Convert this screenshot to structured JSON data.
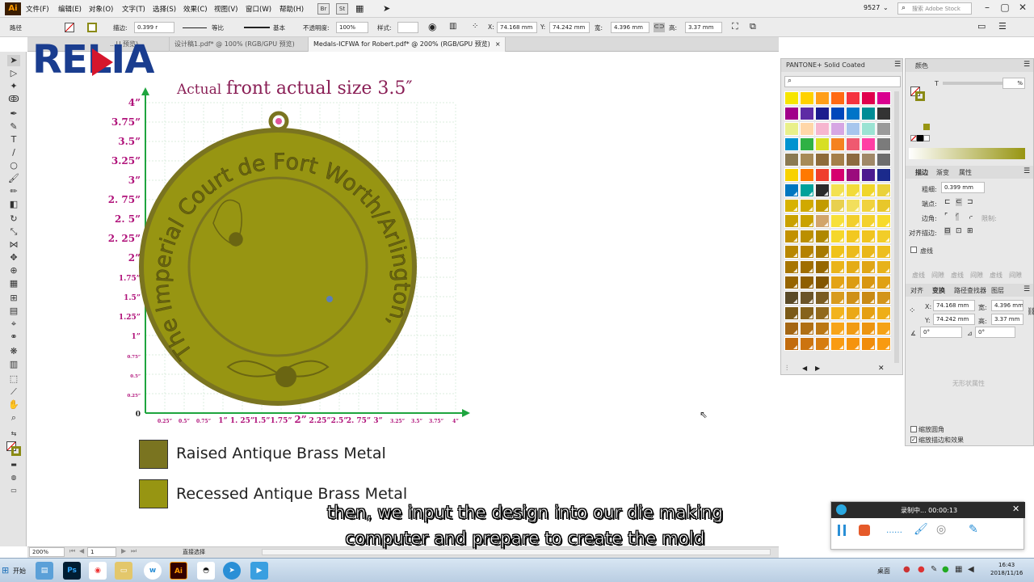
{
  "menubar": {
    "items": [
      "文件(F)",
      "编辑(E)",
      "对象(O)",
      "文字(T)",
      "选择(S)",
      "效果(C)",
      "视图(V)",
      "窗口(W)",
      "帮助(H)"
    ],
    "app_icon": "Ai",
    "bridge_btn": "Br",
    "stock_btn": "St",
    "workspace_value": "9527",
    "search_placeholder": "搜索 Adobe Stock"
  },
  "controlbar": {
    "path_label": "路径",
    "stroke_label": "描边:",
    "stroke_value": "0.399 r",
    "profile_value": "等比",
    "brush_value": "基本",
    "opacity_label": "不透明度:",
    "opacity_value": "100%",
    "style_label": "样式:",
    "x_label": "X:",
    "x_value": "74.168 mm",
    "y_label": "Y:",
    "y_value": "74.242 mm",
    "w_label": "宽:",
    "w_value": "4.396 mm",
    "h_label": "高:",
    "h_value": "3.37 mm"
  },
  "doctabs": [
    {
      "label": "...U 预览)"
    },
    {
      "label": "设计稿1.pdf* @ 100% (RGB/GPU 预览)"
    },
    {
      "label": "Medals-ICFWA for Robert.pdf* @ 200% (RGB/GPU 预览)"
    }
  ],
  "watermark": {
    "brand": "RELIA"
  },
  "artboard": {
    "title_small": "Actual",
    "title_large": "front actual size 3.5″",
    "y_ticks": [
      "4”",
      "3.75”",
      "3.5”",
      "3.25”",
      "3”",
      "2. 75”",
      "2. 5”",
      "2. 25”",
      "2”",
      "1.75”",
      "1.5”",
      "1.25”",
      "1”",
      "0.75”",
      "0.5”",
      "0.25”",
      "0"
    ],
    "x_ticks": [
      "0.25”",
      "0.5”",
      "0.75”",
      "1”",
      "1. 25”",
      "1.5”",
      "1.75”",
      "2”",
      "2.25”",
      "2.5”",
      "2. 75”",
      "3”",
      "3.25”",
      "3.5”",
      "3.75”",
      "4”"
    ],
    "medal_text": "The Imperial Court de Fort Worth/Arlington, Inc",
    "legend": [
      {
        "label": "Raised Antique  Brass Metal",
        "color": "#7a7420"
      },
      {
        "label": "Recessed  Antique  Brass Metal",
        "color": "#979512"
      }
    ]
  },
  "swatches_panel": {
    "title": "PANTONE+ Solid Coated",
    "colors_rows": [
      [
        "#f6e500",
        "#ffd200",
        "#ff9e18",
        "#ff6a13",
        "#f5333f",
        "#e0004d",
        "#d9008f"
      ],
      [
        "#a1008a",
        "#5e2ca5",
        "#1c1c8e",
        "#0047bb",
        "#0074c8",
        "#008c95",
        "#333333"
      ],
      [
        "#e9f08a",
        "#ffd7a8",
        "#f6b6cf",
        "#d6a6e3",
        "#a7c6ed",
        "#9be3d3",
        "#9a9a9a"
      ],
      [
        "#0093d0",
        "#2fb144",
        "#d7df23",
        "#f58220",
        "#ef5a70",
        "#ff3fa4",
        "#7b7b7b"
      ],
      [
        "#8a7a52",
        "#a78a57",
        "#8e6b3a",
        "#a57f4a",
        "#8d6a3f",
        "#a08868",
        "#6d6d6d"
      ],
      [
        "#f8d200",
        "#ff7900",
        "#ef3e2d",
        "#d6006f",
        "#9b0b7d",
        "#4b1c8f",
        "#1b2a8c"
      ],
      [
        "#0077c0",
        "#00a19a",
        "#2a2a2a",
        "#f3e14f",
        "#f2db3a",
        "#f0d62a",
        "#ead23a"
      ],
      [
        "#d7b200",
        "#d0a900",
        "#c29b00",
        "#e8d04e",
        "#f2df5c",
        "#f0d23e",
        "#e8c72a"
      ],
      [
        "#c9a100",
        "#caa200",
        "#d2a56b",
        "#f7e03a",
        "#f2cf2c",
        "#f3d12e",
        "#f7da2a"
      ],
      [
        "#c29100",
        "#bb8f00",
        "#b08800",
        "#f5d72a",
        "#f2c820",
        "#f0c41f",
        "#f2cd28"
      ],
      [
        "#b88700",
        "#b58200",
        "#a77a00",
        "#efc21a",
        "#ecbb1a",
        "#e9b71a",
        "#edbe1e"
      ],
      [
        "#a77500",
        "#a06e00",
        "#966700",
        "#eab41a",
        "#e4ac16",
        "#e0a616",
        "#e7b21b"
      ],
      [
        "#966400",
        "#8f5f00",
        "#835600",
        "#e3a316",
        "#dc9c12",
        "#d89611",
        "#e0a114"
      ],
      [
        "#5a4a28",
        "#6b5428",
        "#7a5c22",
        "#d89b1e",
        "#cf9018",
        "#c98a15",
        "#d3951b"
      ],
      [
        "#7b5a18",
        "#86621b",
        "#91691c",
        "#f2b31c",
        "#eba816",
        "#e5a013",
        "#eeae18"
      ],
      [
        "#a46614",
        "#b06f14",
        "#bb7714",
        "#f7a41a",
        "#f19b14",
        "#ec9411",
        "#f5a216"
      ],
      [
        "#c26c0e",
        "#cc740f",
        "#d67c10",
        "#f99b12",
        "#f5930d",
        "#f08c0b",
        "#f89a10"
      ]
    ]
  },
  "color_panel": {
    "title": "颜色",
    "tint_label": "T",
    "tint_value": "%"
  },
  "stroke_panel": {
    "tabs": [
      "描边",
      "渐变",
      "属性"
    ],
    "weight_label": "粗细:",
    "weight_value": "0.399 mm",
    "cap_label": "端点:",
    "corner_label": "边角:",
    "limit_label": "限制:",
    "align_label": "对齐描边:",
    "dash_label": "虚线",
    "dash_cols": [
      "虚线",
      "间隙",
      "虚线",
      "间隙",
      "虚线",
      "间隙"
    ]
  },
  "transform_panel": {
    "tabs": [
      "对齐",
      "变换",
      "路径查找器",
      "图层"
    ],
    "x_label": "X:",
    "x_value": "74.168 mm",
    "w_label": "宽:",
    "w_value": "4.396 mm",
    "y_label": "Y:",
    "y_value": "74.242 mm",
    "h_label": "高:",
    "h_value": "3.37 mm",
    "angle_value": "0°",
    "shear_value": "0°",
    "no_shape_text": "无形状属性",
    "scale_corners": "缩放圆角",
    "scale_strokes": "缩放描边和效果"
  },
  "statusbar": {
    "zoom": "200%",
    "page": "1",
    "tool": "直接选择"
  },
  "recorder": {
    "status": "录制中... 00:00:13"
  },
  "subtitles": {
    "line1": "then, we input the design into our die making",
    "line2": "computer and prepare to create the mold"
  },
  "taskbar": {
    "start_label": "开始",
    "desktop_label": "桌面",
    "time": "16:43",
    "date": "2018/11/16"
  },
  "colors": {
    "medal_fill": "#979512",
    "medal_rim": "#7a7420",
    "axis_green": "#1fa53f",
    "title_purple": "#8a1f56",
    "tick_magenta": "#b0127a"
  }
}
